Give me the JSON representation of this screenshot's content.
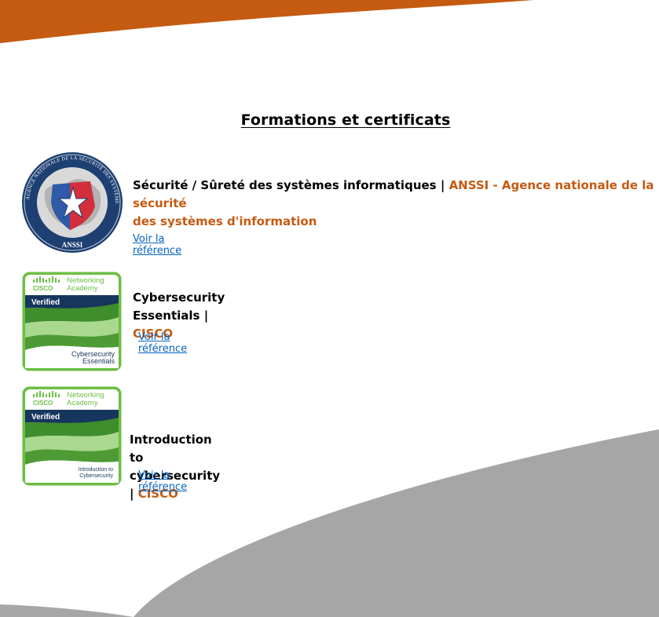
{
  "page": {
    "title": "Formations et certificats"
  },
  "certificates": [
    {
      "title": "Sécurité / Sûreté des systèmes informatiques",
      "separator": "|",
      "org_line1": "ANSSI - Agence nationale de la sécurité",
      "org_line2": "des systèmes d'information",
      "link": "Voir la référence",
      "badge": {
        "ring_text": "AGENCE NATIONALE DE LA SÉCURITÉ DES SYSTÈMES D'INFORMATION",
        "bottom_text": "ANSSI"
      }
    },
    {
      "title": "Cybersecurity Essentials",
      "separator": "|",
      "org": "CISCO",
      "link": "Voir la référence",
      "badge": {
        "brand": "CISCO",
        "line1": "Networking",
        "line2": "Academy",
        "verified": "Verified",
        "course_line1": "Cybersecurity",
        "course_line2": "Essentials"
      }
    },
    {
      "title": "Introduction to cybersecurity",
      "separator": "|",
      "org": "CISCO",
      "link": "Voir la référence",
      "badge": {
        "brand": "CISCO",
        "line1": "Networking",
        "line2": "Academy",
        "verified": "Verified",
        "course_line1": "Introduction to",
        "course_line2": "Cybersecurity"
      }
    }
  ],
  "colors": {
    "accent_orange": "#c55a11",
    "link_blue": "#0563c1",
    "decor_gray": "#a6a6a6",
    "badge_green": "#6cbe45"
  }
}
